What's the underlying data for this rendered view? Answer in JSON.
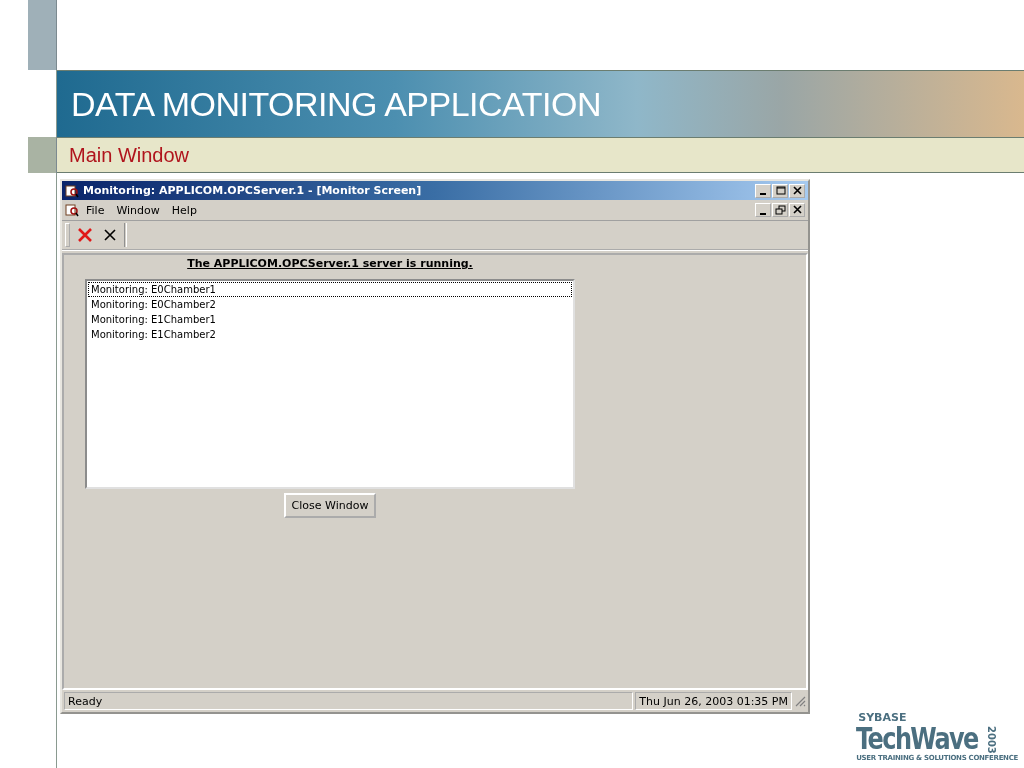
{
  "slide": {
    "title": "DATA MONITORING APPLICATION",
    "subtitle": "Main Window"
  },
  "window": {
    "title": "Monitoring: APPLICOM.OPCServer.1 - [Monitor Screen]",
    "menu": [
      "File",
      "Window",
      "Help"
    ],
    "status_message": "The APPLICOM.OPCServer.1 server is running.",
    "list_items": [
      {
        "label": "Monitoring: E0Chamber1",
        "selected": true
      },
      {
        "label": "Monitoring: E0Chamber2",
        "selected": false
      },
      {
        "label": "Monitoring: E1Chamber1",
        "selected": false
      },
      {
        "label": "Monitoring: E1Chamber2",
        "selected": false
      }
    ],
    "buttons": [
      "Close Window"
    ],
    "status_bar": [
      "Ready",
      "Thu Jun 26, 2003 01:35 PM"
    ]
  },
  "logo": {
    "brand": "SYBASE",
    "name": "TechWave",
    "year": "2003",
    "tagline": "USER TRAINING & SOLUTIONS CONFERENCE"
  }
}
